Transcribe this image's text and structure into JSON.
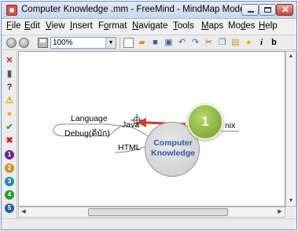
{
  "window": {
    "title": "Computer Knowledge .mm - FreeMind - MindMap Mode"
  },
  "menu": [
    {
      "label": "File",
      "ul": "F"
    },
    {
      "label": "Edit",
      "ul": "E"
    },
    {
      "label": "View",
      "ul": "V"
    },
    {
      "label": "Insert",
      "ul": "I"
    },
    {
      "label": "Format",
      "ul": "o"
    },
    {
      "label": "Navigate",
      "ul": "N"
    },
    {
      "label": "Tools",
      "ul": "T"
    },
    {
      "label": "Maps",
      "ul": "M"
    },
    {
      "label": "Modes",
      "ul": "d"
    },
    {
      "label": "Help",
      "ul": "H"
    }
  ],
  "toolbar": {
    "zoom": "100%",
    "icons": [
      "new-map-icon",
      "open-icon",
      "save-icon",
      "save-as-icon",
      "undo-icon",
      "redo-icon",
      "cut-icon",
      "copy-icon",
      "paste-icon",
      "idea-icon",
      "italic-icon",
      "bold-icon"
    ],
    "italic_label": "i",
    "bold_label": "b"
  },
  "iconbar": {
    "items": [
      "remove-last-icon",
      "trash-icon",
      "question-icon",
      "warning-icon",
      "idea-icon",
      "ok-icon",
      "not-ok-icon",
      "priority-1-icon",
      "priority-2-icon",
      "priority-3-icon",
      "priority-4-icon",
      "priority-5-icon"
    ]
  },
  "mindmap": {
    "root": {
      "line1": "Computer",
      "line2": "Knowledge"
    },
    "nodes": {
      "language": "Language",
      "debug": "Debug(ดีบัก)",
      "java": "Java",
      "html": "HTML",
      "unix_fragment": "nix"
    },
    "callout_number": "1",
    "arrow_color": "#d93a2b",
    "root_text_color": "#2c5aa0"
  }
}
